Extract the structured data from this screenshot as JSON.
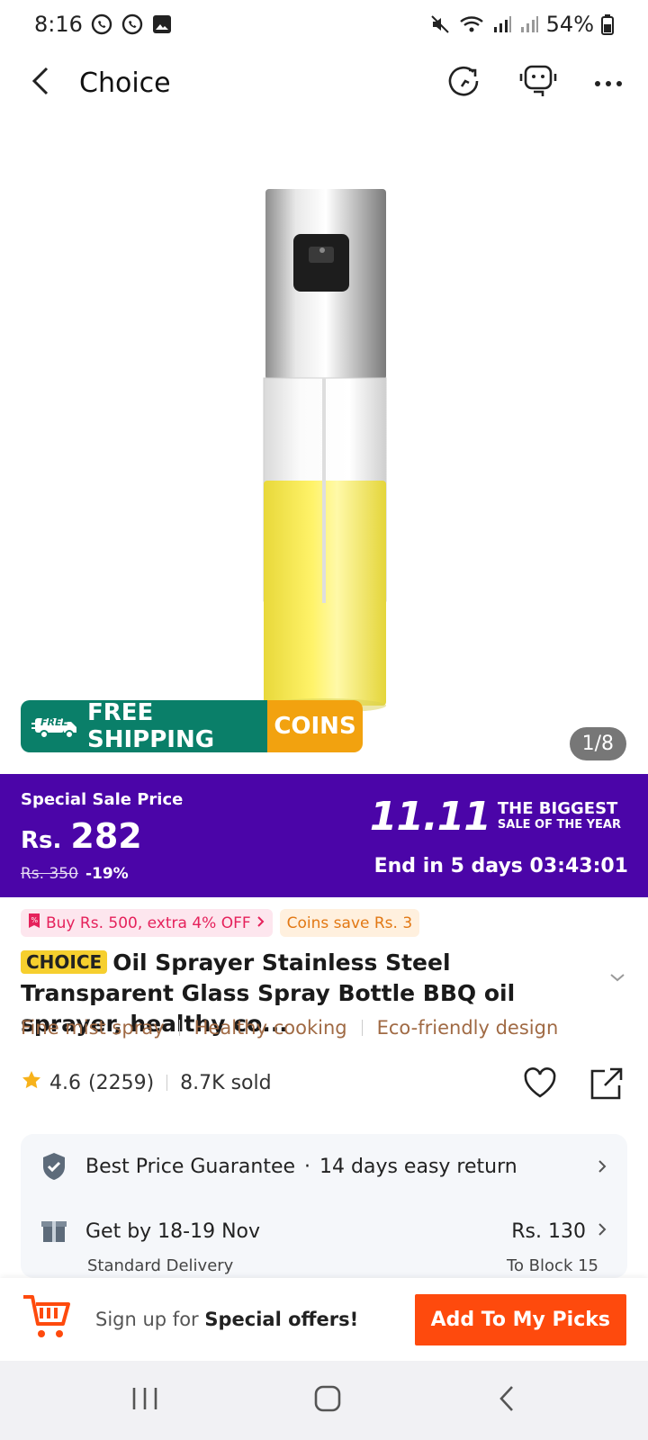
{
  "status_bar": {
    "time": "8:16",
    "battery": "54%",
    "left_icons": [
      "whatsapp-icon",
      "whatsapp-icon",
      "gallery-icon"
    ],
    "right_icons": [
      "mute-icon",
      "wifi-icon",
      "signal-icon",
      "signal-icon",
      "battery-icon"
    ]
  },
  "appbar": {
    "title": "Choice",
    "icons": [
      "back-icon",
      "history-icon",
      "support-icon",
      "more-icon"
    ]
  },
  "gallery": {
    "counter": "1/8",
    "promo_free_badge": "FREE",
    "promo_shipping": "FREE SHIPPING",
    "promo_coins": "COINS"
  },
  "sale": {
    "label": "Special Sale Price",
    "currency": "Rs.",
    "price": "282",
    "old_price": "Rs. 350",
    "discount": "-19%",
    "event_number": "11.11",
    "event_line1": "THE BIGGEST",
    "event_line2": "SALE OF THE YEAR",
    "countdown": "End in 5 days 03:43:01",
    "color": "#4b05a8"
  },
  "coupons": {
    "extra_off": "Buy Rs. 500, extra 4% OFF",
    "coins_save": "Coins save Rs. 3"
  },
  "product": {
    "badge": "CHOICE",
    "title": "Oil Sprayer Stainless Steel Transparent Glass Spray Bottle BBQ oil sprayer, healthy co...",
    "features": [
      "Fine mist spray",
      "Healthy cooking",
      "Eco-friendly design"
    ],
    "rating": "4.6",
    "reviews": "(2259)",
    "sold": "8.7K sold"
  },
  "info_card": {
    "guarantee": "Best Price Guarantee",
    "returns": "14 days easy return",
    "delivery": "Get by 18-19 Nov",
    "delivery_price": "Rs. 130",
    "delivery_type": "Standard Delivery",
    "destination": "To Block 15"
  },
  "bottom_bar": {
    "signup_prefix": "Sign up for ",
    "signup_bold": "Special offers!",
    "picks_button": "Add To My Picks",
    "accent": "#fe4a0d"
  }
}
